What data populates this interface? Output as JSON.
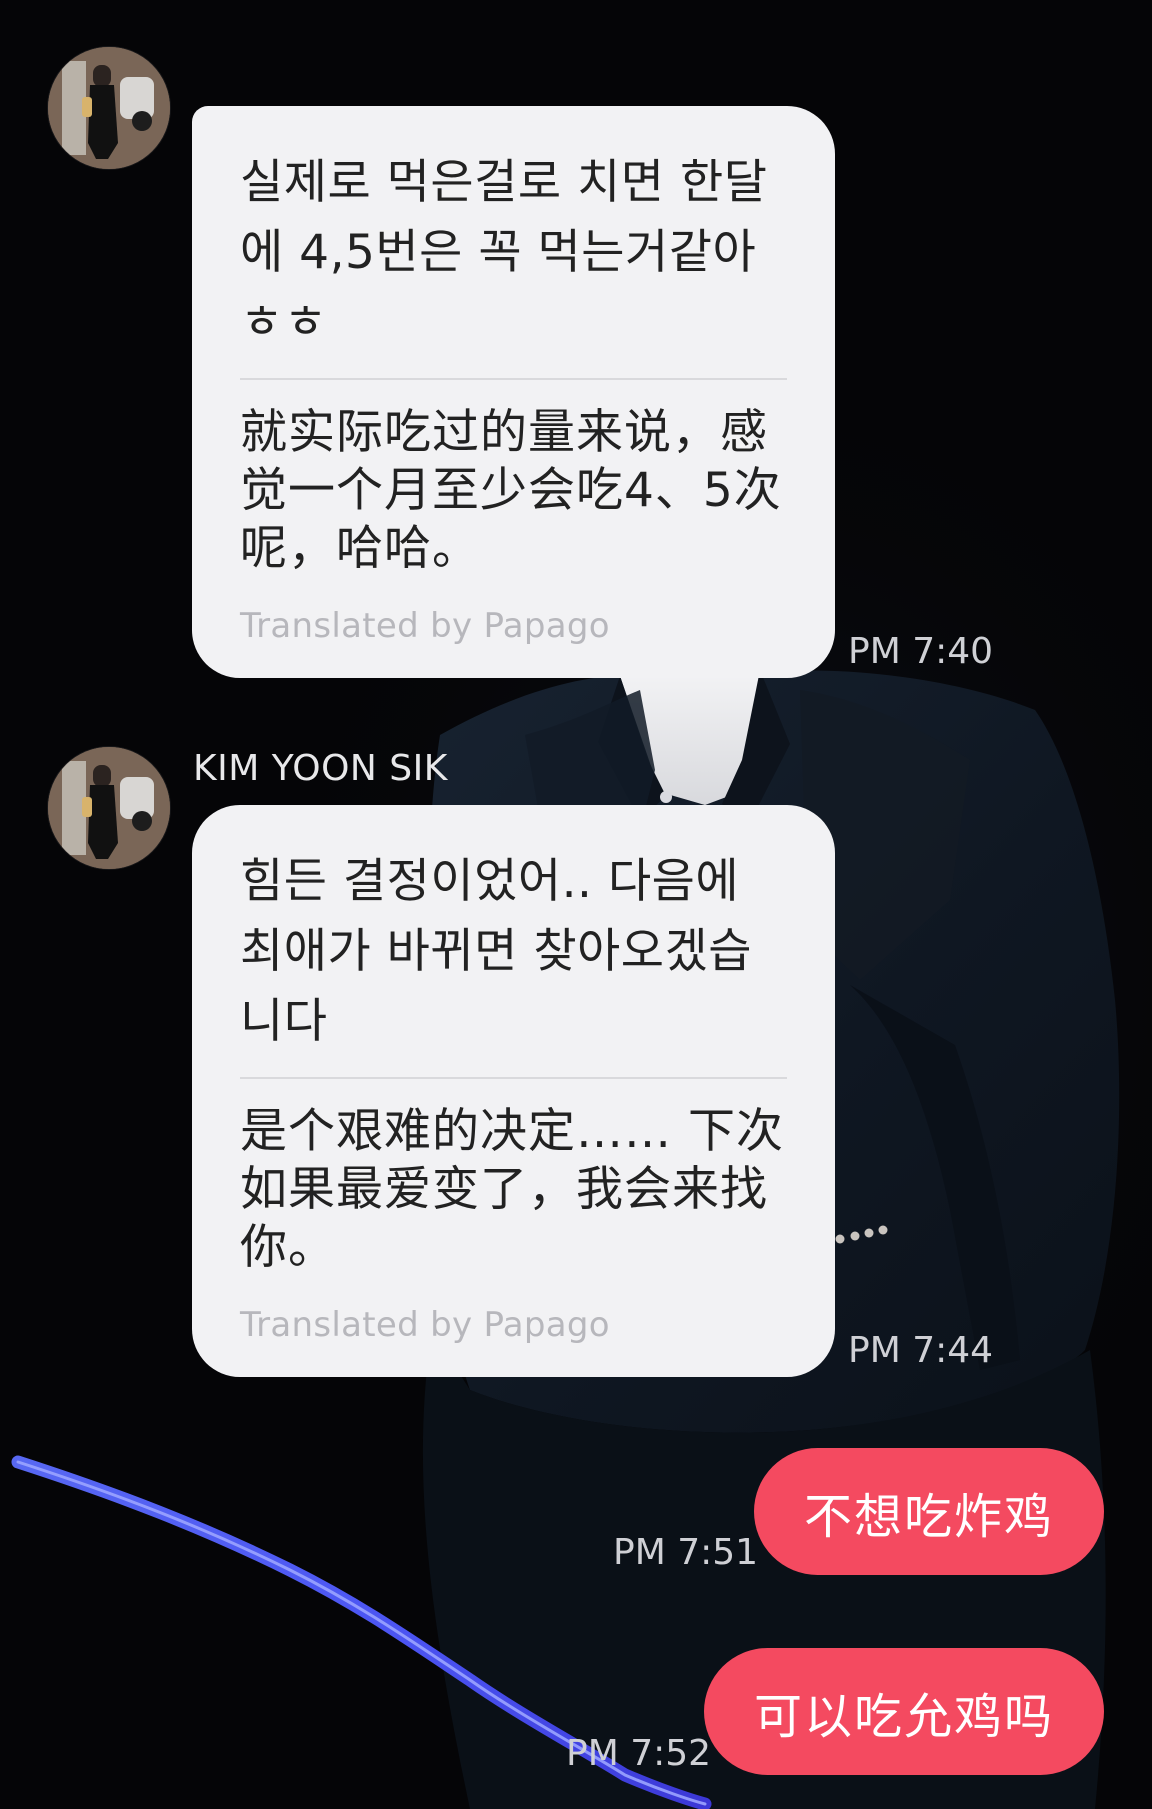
{
  "chat": {
    "contact_name": "KIM YOON SIK",
    "messages": [
      {
        "direction": "incoming",
        "original": "실제로 먹은걸로 치면 한달에 4,5번은 꼭 먹는거같아ㅎㅎ",
        "translation": "就实际吃过的量来说，感觉一个月至少会吃4、5次呢，哈哈。",
        "translator_note": "Translated by Papago",
        "time": "PM 7:40"
      },
      {
        "direction": "incoming",
        "original": "힘든 결정이었어.. 다음에 최애가 바뀌면 찾아오겠습니다",
        "translation": "是个艰难的决定…… 下次如果最爱变了，我会来找你。",
        "translator_note": "Translated by Papago",
        "time": "PM 7:44"
      },
      {
        "direction": "outgoing",
        "text": "不想吃炸鸡",
        "time": "PM 7:51"
      },
      {
        "direction": "outgoing",
        "text": "可以吃允鸡吗",
        "time": "PM 7:52"
      }
    ]
  },
  "icons": {
    "avatar": "profile-photo-icon"
  },
  "colors": {
    "background": "#050507",
    "incoming_bubble": "#f2f2f4",
    "outgoing_bubble": "#f44a60",
    "timestamp": "#cfd0d5",
    "translator_note": "#b7b7bc"
  }
}
